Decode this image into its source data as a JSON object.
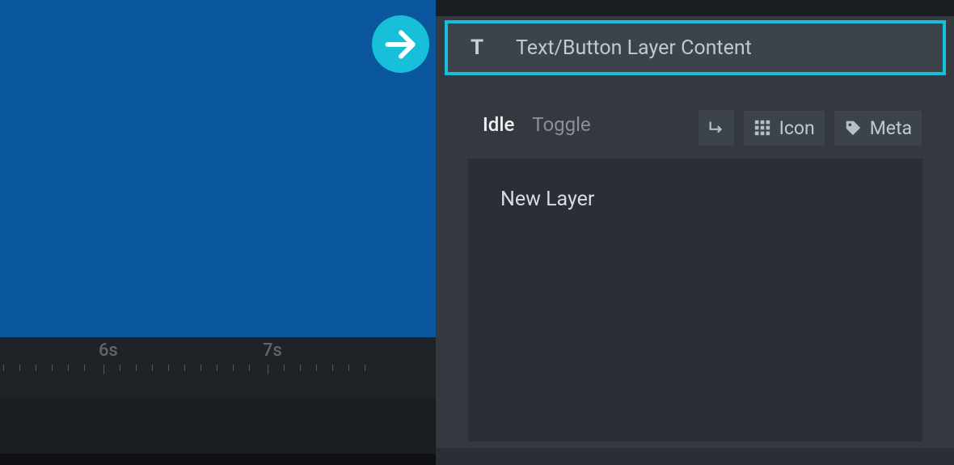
{
  "header": {
    "icon_letter": "T",
    "title": "Text/Button Layer Content"
  },
  "tabs": {
    "active": "Idle",
    "inactive": "Toggle"
  },
  "tools": {
    "icon_label": "Icon",
    "meta_label": "Meta"
  },
  "content": {
    "layer_name": "New Layer"
  },
  "timeline": {
    "marker_6": "6s",
    "marker_7": "7s"
  }
}
